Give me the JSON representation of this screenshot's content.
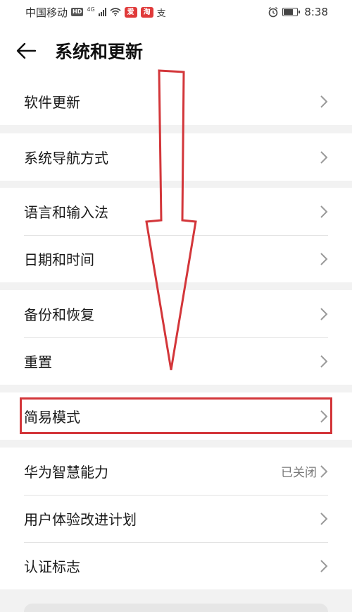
{
  "status_bar": {
    "carrier": "中国移动",
    "hd": "HD",
    "network": "4G",
    "app_badge_1": "爱",
    "app_badge_2": "淘",
    "alipay": "支",
    "time": "8:38"
  },
  "header": {
    "title": "系统和更新"
  },
  "groups": [
    {
      "items": [
        {
          "label": "软件更新"
        }
      ]
    },
    {
      "items": [
        {
          "label": "系统导航方式"
        }
      ]
    },
    {
      "items": [
        {
          "label": "语言和输入法"
        },
        {
          "label": "日期和时间"
        }
      ]
    },
    {
      "items": [
        {
          "label": "备份和恢复"
        },
        {
          "label": "重置"
        }
      ]
    },
    {
      "items": [
        {
          "label": "简易模式"
        }
      ]
    },
    {
      "items": [
        {
          "label": "华为智慧能力",
          "value": "已关闭"
        },
        {
          "label": "用户体验改进计划"
        },
        {
          "label": "认证标志"
        }
      ]
    }
  ],
  "annotation": {
    "highlight_color": "#d3363a",
    "highlighted_item": "简易模式"
  },
  "colors": {
    "background": "#f2f2f2",
    "card": "#ffffff",
    "chevron": "#9a9a9a"
  }
}
